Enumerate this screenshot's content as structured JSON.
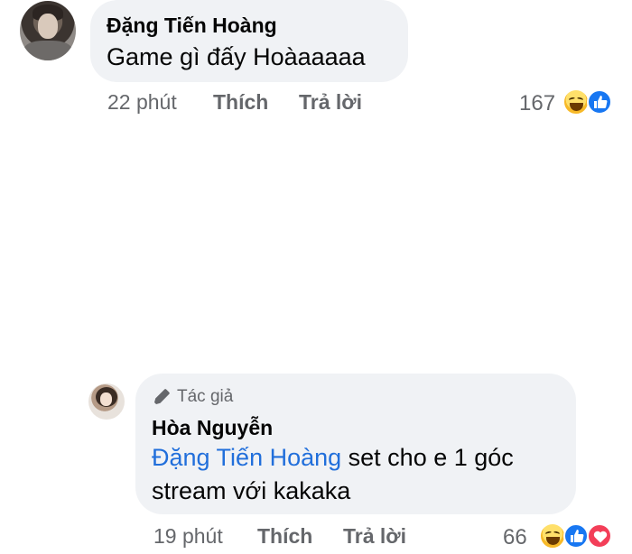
{
  "comments": [
    {
      "author": "Đặng Tiến Hoàng",
      "text": "Game gì đấy Hoàaaaaa",
      "time": "22 phút",
      "like_label": "Thích",
      "reply_label": "Trả lời",
      "reaction_count": "167",
      "reactions": [
        "haha-icon",
        "like-icon"
      ]
    },
    {
      "author_badge": "Tác giả",
      "author": "Hòa Nguyễn",
      "mention": "Đặng Tiến Hoàng",
      "text_after_mention": " set cho e 1 góc",
      "text_line2": "stream với kakaka",
      "time": "19 phút",
      "like_label": "Thích",
      "reply_label": "Trả lời",
      "reaction_count": "66",
      "reactions": [
        "haha-icon",
        "like-icon",
        "love-icon"
      ]
    }
  ],
  "colors": {
    "bubble_bg": "#f0f2f5",
    "mention": "#216fdb",
    "meta_text": "#65676b",
    "like_blue": "#1877f2",
    "love_red": "#f33e58",
    "haha_yellow": "#f7b928"
  }
}
